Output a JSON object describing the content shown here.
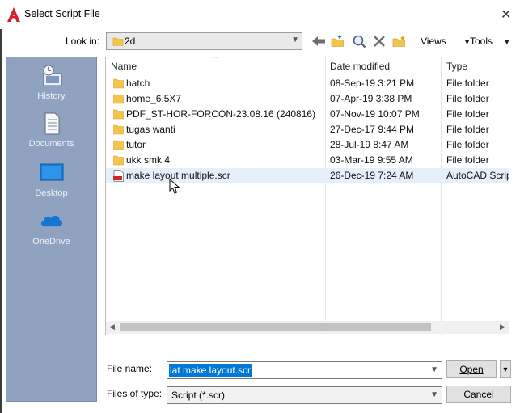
{
  "window": {
    "title": "Select Script File",
    "close": "✕"
  },
  "toolbar": {
    "look_in_label": "Look in:",
    "look_in_value": "2d",
    "views_label": "Views",
    "tools_label": "Tools"
  },
  "places": [
    {
      "label": "History",
      "icon": "history-icon"
    },
    {
      "label": "Documents",
      "icon": "documents-icon"
    },
    {
      "label": "Desktop",
      "icon": "desktop-icon"
    },
    {
      "label": "OneDrive",
      "icon": "onedrive-icon"
    }
  ],
  "columns": {
    "name": "Name",
    "date": "Date modified",
    "type": "Type"
  },
  "files": [
    {
      "name": "hatch",
      "date": "08-Sep-19 3:21 PM",
      "type": "File folder",
      "kind": "folder"
    },
    {
      "name": "home_6.5X7",
      "date": "07-Apr-19 3:38 PM",
      "type": "File folder",
      "kind": "folder"
    },
    {
      "name": "PDF_ST-HOR-FORCON-23.08.16  (240816)",
      "date": "07-Nov-19 10:07 PM",
      "type": "File folder",
      "kind": "folder"
    },
    {
      "name": "tugas wanti",
      "date": "27-Dec-17 9:44 PM",
      "type": "File folder",
      "kind": "folder"
    },
    {
      "name": "tutor",
      "date": "28-Jul-19 8:47 AM",
      "type": "File folder",
      "kind": "folder"
    },
    {
      "name": "ukk smk 4",
      "date": "03-Mar-19 9:55 AM",
      "type": "File folder",
      "kind": "folder"
    },
    {
      "name": "make layout multiple.scr",
      "date": "26-Dec-19 7:24 AM",
      "type": "AutoCAD Script",
      "kind": "scr"
    }
  ],
  "bottom": {
    "file_name_label": "File name:",
    "file_name_value": "lat make layout.scr",
    "files_of_type_label": "Files of type:",
    "files_of_type_value": "Script (*.scr)",
    "open_label": "Open",
    "cancel_label": "Cancel"
  },
  "colors": {
    "places_bg": "#8fa3c0",
    "folder": "#f3c54a",
    "selection": "#0078d7"
  }
}
